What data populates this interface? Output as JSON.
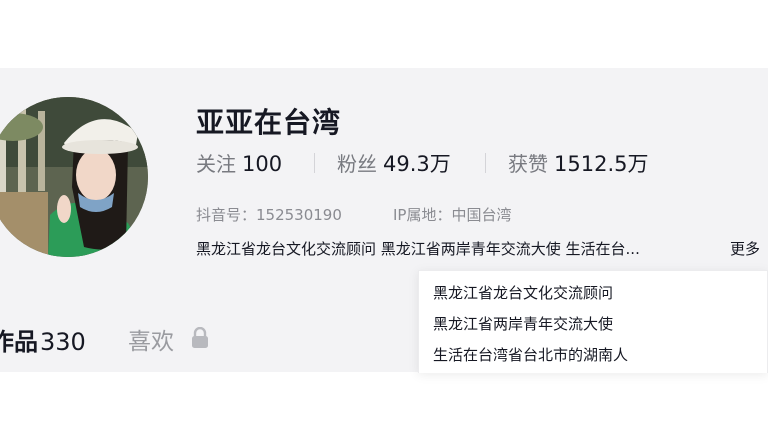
{
  "profile": {
    "name": "亚亚在台湾",
    "stats": [
      {
        "label": "关注",
        "value": "100"
      },
      {
        "label": "粉丝",
        "value": "49.3万"
      },
      {
        "label": "获赞",
        "value": "1512.5万"
      }
    ],
    "douyin_id": "抖音号：152530190",
    "ip_location": "IP属地：中国台湾",
    "bio_truncated": "黑龙江省龙台文化交流顾问 黑龙江省两岸青年交流大使 生活在台...",
    "more_label": "更多",
    "bio_popup_lines": [
      "黑龙江省龙台文化交流顾问",
      "黑龙江省两岸青年交流大使",
      "生活在台湾省台北市的湖南人"
    ]
  },
  "tabs": {
    "works_label": "作品",
    "works_count": "330",
    "likes_label": "喜欢",
    "likes_icon": "lock-icon"
  },
  "colors": {
    "text_primary": "#161823",
    "text_secondary": "#787a80",
    "band_bg": "#f3f3f5"
  }
}
